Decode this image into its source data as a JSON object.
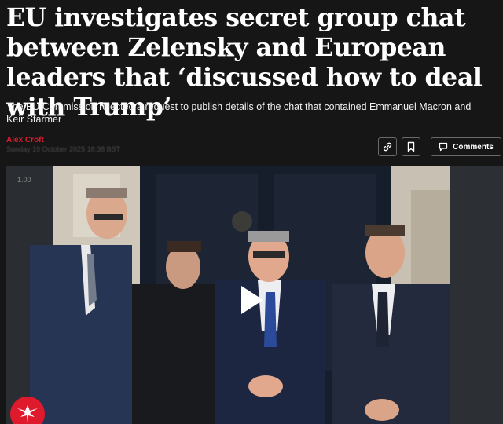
{
  "article": {
    "headline": "EU investigates secret group chat between Zelensky and European leaders that ‘discussed how to deal with Trump’",
    "standfirst": "The EU Commission rejected a request to publish details of the chat that contained Emmanuel Macron and Keir Starmer",
    "author": "Alex Croft",
    "dateline": "Sunday 19 October 2025 18:38 BST"
  },
  "toolbar": {
    "link_icon": "link-icon",
    "bookmark_icon": "bookmark-icon",
    "comments_icon": "comment-icon",
    "comments_label": "Comments"
  },
  "media": {
    "timestamp": "1.00",
    "play_icon": "play-icon",
    "logo_icon": "eagle-logo"
  },
  "colors": {
    "background": "#161616",
    "author": "#e01a2d",
    "logo": "#e01a2d"
  }
}
